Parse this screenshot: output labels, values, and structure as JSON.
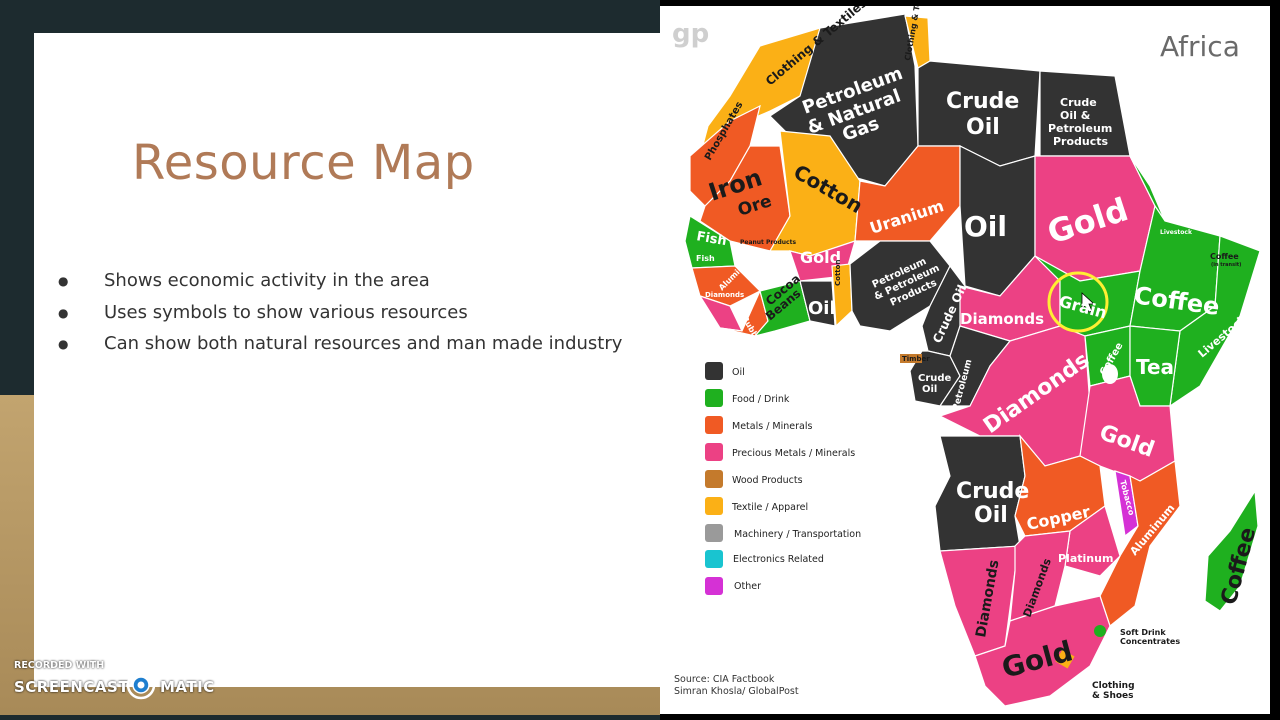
{
  "slide": {
    "title": "Resource Map",
    "bullets": [
      "Shows economic activity in the area",
      "Uses symbols to show various resources",
      "Can show both natural resources and man made industry"
    ]
  },
  "map": {
    "title": "Africa",
    "logo": "gp",
    "labels": {
      "clothing_textiles_nw": "Clothing & Textiles",
      "clothing_textiles_ne": "Clothing & Textiles",
      "petroleum_gas_1": "Petroleum",
      "petroleum_gas_2": "& Natural",
      "petroleum_gas_3": "Gas",
      "crude_oil_libya_1": "Crude",
      "crude_oil_libya_2": "Oil",
      "crude_oil_egypt_1": "Crude",
      "crude_oil_egypt_2": "Oil &",
      "crude_oil_egypt_3": "Petroleum",
      "crude_oil_egypt_4": "Products",
      "phosphates": "Phosphates",
      "iron_ore_1": "Iron",
      "iron_ore_2": "Ore",
      "cotton_mali": "Cotton",
      "uranium": "Uranium",
      "oil_chad": "Oil",
      "gold_sudan": "Gold",
      "livestock_n": "Livestock",
      "coffee_small": "Coffee",
      "coffee_small_sub": "(in transit)",
      "fish_1": "Fish",
      "fish_2": "Fish",
      "peanut_products": "Peanut Products",
      "aluminum_w": "Aluminum",
      "diamonds_w": "Diamonds",
      "rubber": "Rubber",
      "gold_w": "Gold",
      "cotton_w": "Cotton",
      "cocoa_beans_1": "Cocoa",
      "cocoa_beans_2": "Beans",
      "oil_nigeria": "Oil",
      "petroleum_products_1": "Petroleum",
      "petroleum_products_2": "& Petroleum",
      "petroleum_products_3": "Products",
      "crude_oil_cam": "Crude Oil",
      "diamonds_car": "Diamonds",
      "grain": "Grain",
      "coffee_eth": "Coffee",
      "livestock_som": "Livestock",
      "coffee_uganda": "Coffee",
      "tea": "Tea",
      "timber": "Timber",
      "crude_oil_gab_1": "Crude",
      "crude_oil_gab_2": "Oil",
      "petroleum_congo": "Petroleum",
      "diamonds_drc": "Diamonds",
      "gold_tz": "Gold",
      "tobacco": "Tobacco",
      "crude_oil_ang_1": "Crude",
      "crude_oil_ang_2": "Oil",
      "copper": "Copper",
      "aluminum_moz": "Aluminum",
      "platinum": "Platinum",
      "diamonds_nam": "Diamonds",
      "diamonds_bots": "Diamonds",
      "gold_sa": "Gold",
      "coffee_mad": "Coffee",
      "soft_drink_1": "Soft Drink",
      "soft_drink_2": "Concentrates",
      "clothing_shoes_1": "Clothing",
      "clothing_shoes_2": "& Shoes"
    },
    "legend": [
      {
        "label": "Oil",
        "color": "#333333"
      },
      {
        "label": "Food / Drink",
        "color": "#1fb01f"
      },
      {
        "label": "Metals / Minerals",
        "color": "#f05a24"
      },
      {
        "label": "Precious Metals / Minerals",
        "color": "#ec4184"
      },
      {
        "label": "Wood Products",
        "color": "#c47a2c"
      },
      {
        "label": "Textile / Apparel",
        "color": "#fbb016"
      },
      {
        "label": "Machinery / Transportation",
        "color": "#9a9a9a"
      },
      {
        "label": "Electronics Related",
        "color": "#19c4d0"
      },
      {
        "label": "Other",
        "color": "#d531d5"
      }
    ],
    "source_1": "Source: CIA Factbook",
    "source_2": "Simran Khosla/ GlobalPost"
  },
  "watermark": {
    "top": "RECORDED WITH",
    "left": "SCREENCAST",
    "right": "MATIC"
  },
  "colors": {
    "oil": "#333333",
    "food": "#1fb01f",
    "metals": "#f05a24",
    "precious": "#ec4184",
    "wood": "#c47a2c",
    "textile": "#fbb016",
    "other": "#d531d5",
    "title": "#b07a57",
    "gold_band": "#b89a64",
    "dark_band": "#1d2b2f"
  }
}
